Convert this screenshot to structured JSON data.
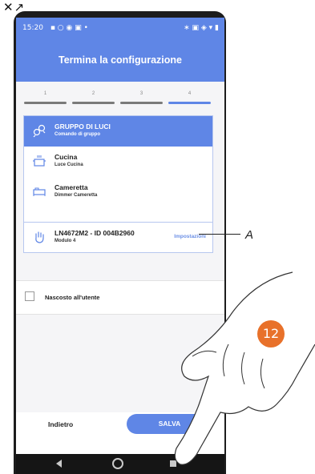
{
  "corner_icons": "✕↗",
  "status_bar": {
    "time": "15:20",
    "left_icons": "▪ ○ ◉ ▣ •",
    "right_icons": "∗ ▣ ◈ ▾ ▮"
  },
  "header": {
    "title": "Termina la configurazione"
  },
  "stepper": {
    "steps": [
      "1",
      "2",
      "3",
      "4"
    ],
    "active_step": 4
  },
  "list": {
    "group": {
      "title": "GRUPPO DI LUCI",
      "subtitle": "Comando di gruppo",
      "icon": "bulbs-icon"
    },
    "items": [
      {
        "title": "Cucina",
        "subtitle": "Luce Cucina",
        "icon": "kitchen-pot-icon"
      },
      {
        "title": "Cameretta",
        "subtitle": "Dimmer Cameretta",
        "icon": "bed-icon"
      }
    ],
    "device": {
      "title": "LN4672M2 - ID 004B2960",
      "subtitle": "Modulo 4",
      "settings_label": "Impostazioni",
      "icon": "hand-icon"
    }
  },
  "callout": {
    "letter": "A"
  },
  "hidden_option": {
    "label": "Nascosto all'utente",
    "checked": false
  },
  "footer": {
    "back_label": "Indietro",
    "save_label": "SALVA"
  },
  "step_badge": "12",
  "colors": {
    "accent": "#5f86e6",
    "badge": "#e8712a"
  }
}
